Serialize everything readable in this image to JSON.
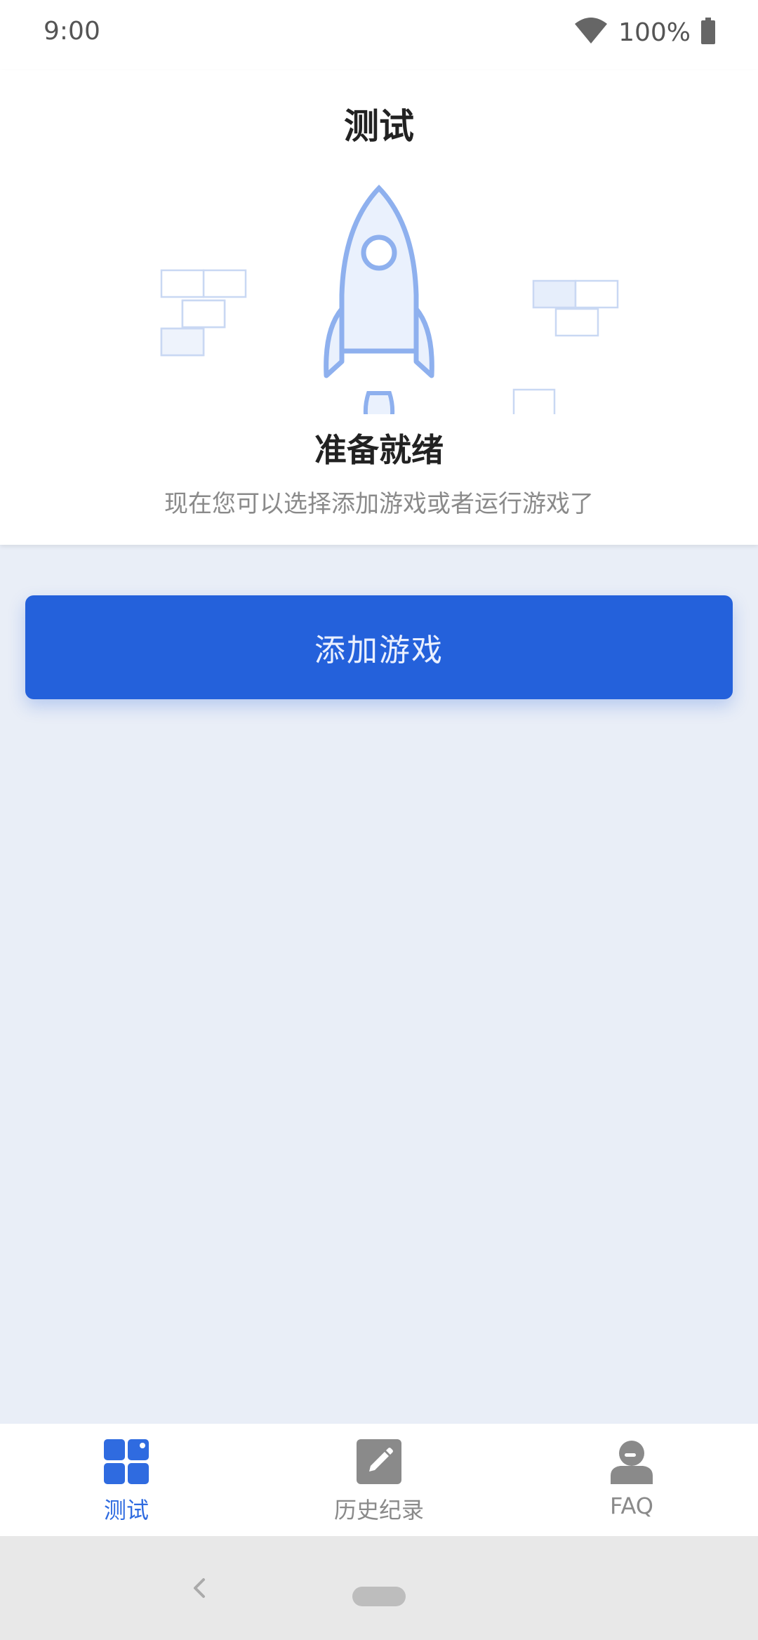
{
  "status_bar": {
    "time": "9:00",
    "battery_percent": "100%",
    "icons": [
      "wifi-icon",
      "battery-icon"
    ]
  },
  "header": {
    "title": "测试",
    "ready_title": "准备就绪",
    "ready_subtitle": "现在您可以选择添加游戏或者运行游戏了"
  },
  "main": {
    "add_game_label": "添加游戏"
  },
  "bottom_nav": {
    "items": [
      {
        "label": "测试",
        "icon": "grid-icon",
        "active": true
      },
      {
        "label": "历史纪录",
        "icon": "edit-icon",
        "active": false
      },
      {
        "label": "FAQ",
        "icon": "support-agent-icon",
        "active": false
      }
    ]
  },
  "colors": {
    "accent": "#2461DB",
    "nav_active": "#2F6BE0",
    "nav_inactive": "#8A8A8A",
    "background": "#E9EEF7"
  }
}
